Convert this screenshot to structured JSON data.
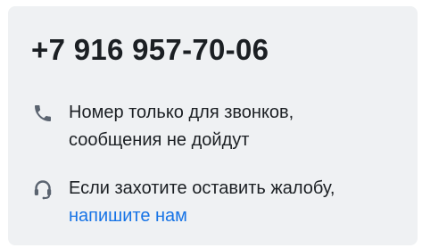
{
  "contact": {
    "phone": "+7 916 957-70-06",
    "calls_note": {
      "icon": "phone-icon",
      "line1": "Номер только для звонков,",
      "line2": "сообщения не дойдут"
    },
    "complaint": {
      "icon": "headset-icon",
      "line1": "Если захотите оставить жалобу,",
      "link": "напишите нам"
    }
  },
  "colors": {
    "card_bg": "#eff1f3",
    "text": "#1b1f23",
    "icon": "#5b6470",
    "link": "#1673e6"
  }
}
